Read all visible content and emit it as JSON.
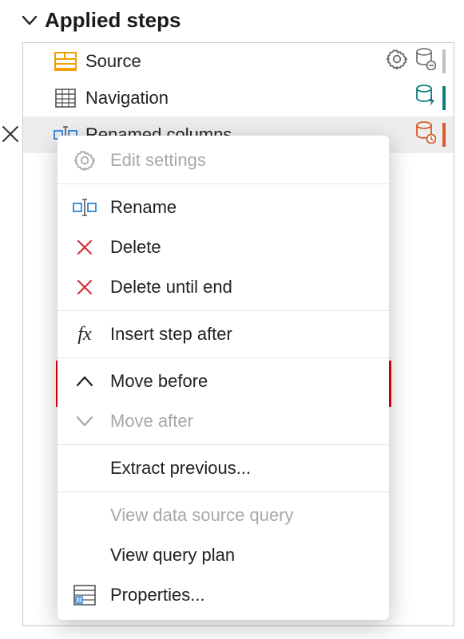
{
  "section": {
    "title": "Applied steps"
  },
  "steps": [
    {
      "label": "Source"
    },
    {
      "label": "Navigation"
    },
    {
      "label": "Renamed columns"
    }
  ],
  "menu": {
    "edit_settings": "Edit settings",
    "rename": "Rename",
    "delete": "Delete",
    "delete_until_end": "Delete until end",
    "insert_step_after": "Insert step after",
    "move_before": "Move before",
    "move_after": "Move after",
    "extract_previous": "Extract previous...",
    "view_data_source_query": "View data source query",
    "view_query_plan": "View query plan",
    "properties": "Properties..."
  }
}
